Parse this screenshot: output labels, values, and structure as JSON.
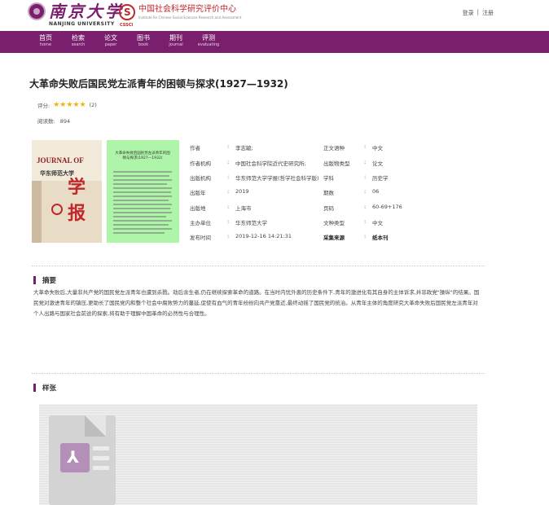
{
  "header": {
    "nju_cn": "南京大学",
    "nju_en": "NANJING UNIVERSITY",
    "cssci_mark_text": "CSSCI",
    "cssci_cn": "中国社会科学研究评价中心",
    "cssci_en": "Institute for Chinese Social Sciences Research and Assessment",
    "login": "登录",
    "separator": "|",
    "register": "注册"
  },
  "nav": [
    {
      "cn": "首页",
      "en": "home"
    },
    {
      "cn": "检索",
      "en": "search"
    },
    {
      "cn": "论文",
      "en": "paper"
    },
    {
      "cn": "图书",
      "en": "book"
    },
    {
      "cn": "期刊",
      "en": "journal"
    },
    {
      "cn": "评测",
      "en": "evaluating"
    }
  ],
  "article": {
    "title": "大革命失败后国民党左派青年的困顿与探求(1927—1932)",
    "rating_label": "评分:",
    "stars": "★★★★★",
    "rating_count": "(2)",
    "reads_label": "阅读数:",
    "reads_value": "894"
  },
  "cover": {
    "journal_en": "JOURNAL OF",
    "journal_name": "华东师范大学",
    "journal_big": "学报",
    "contents_title": "大革命失败后国民党左派青年的困顿与探求(1927—1932)"
  },
  "meta": {
    "left": [
      {
        "label": "作者",
        "value": "李志毓;"
      },
      {
        "label": "作者机构",
        "value": "中国社会科学院近代史研究所;"
      },
      {
        "label": "出版机构",
        "value": "华东师范大学学报(哲学社会科学版)"
      },
      {
        "label": "出版年",
        "value": "2019"
      },
      {
        "label": "出版地",
        "value": "上海市"
      },
      {
        "label": "主办单位",
        "value": "华东师范大学"
      },
      {
        "label": "发布时间",
        "value": "2019-12-16 14:21:31"
      }
    ],
    "right": [
      {
        "label": "正文语种",
        "value": "中文"
      },
      {
        "label": "出版物类型",
        "value": "论文"
      },
      {
        "label": "学科",
        "value": "历史学"
      },
      {
        "label": "期数",
        "value": "06"
      },
      {
        "label": "页码",
        "value": "60-69+176"
      },
      {
        "label": "文种类型",
        "value": "中文"
      },
      {
        "label": "采集来源",
        "value": "纸本刊"
      }
    ],
    "colon": ":"
  },
  "abstract": {
    "heading": "摘要",
    "text": "大革命失败后,大量非共产党的国民党左派青年也遭到杀戮。劫后余生者,仍在继续探索革命的道路。在当时内忧外患的历史条件下,青年的激进化有其自身的主体诉求,并非政党\"操纵\"的结果。国民党对激进青年的镇压,更助长了国民党内和整个社会中腐败势力的蔓延,促使有血气的青年纷纷向共产党靠近,最终动摇了国民党的统治。从青年主体的角度研究大革命失败后国民党左派青年对个人出路与国家社会前途的探索,将有助于理解中国革命的必然性与合理性。"
  },
  "sample": {
    "heading": "样张"
  }
}
